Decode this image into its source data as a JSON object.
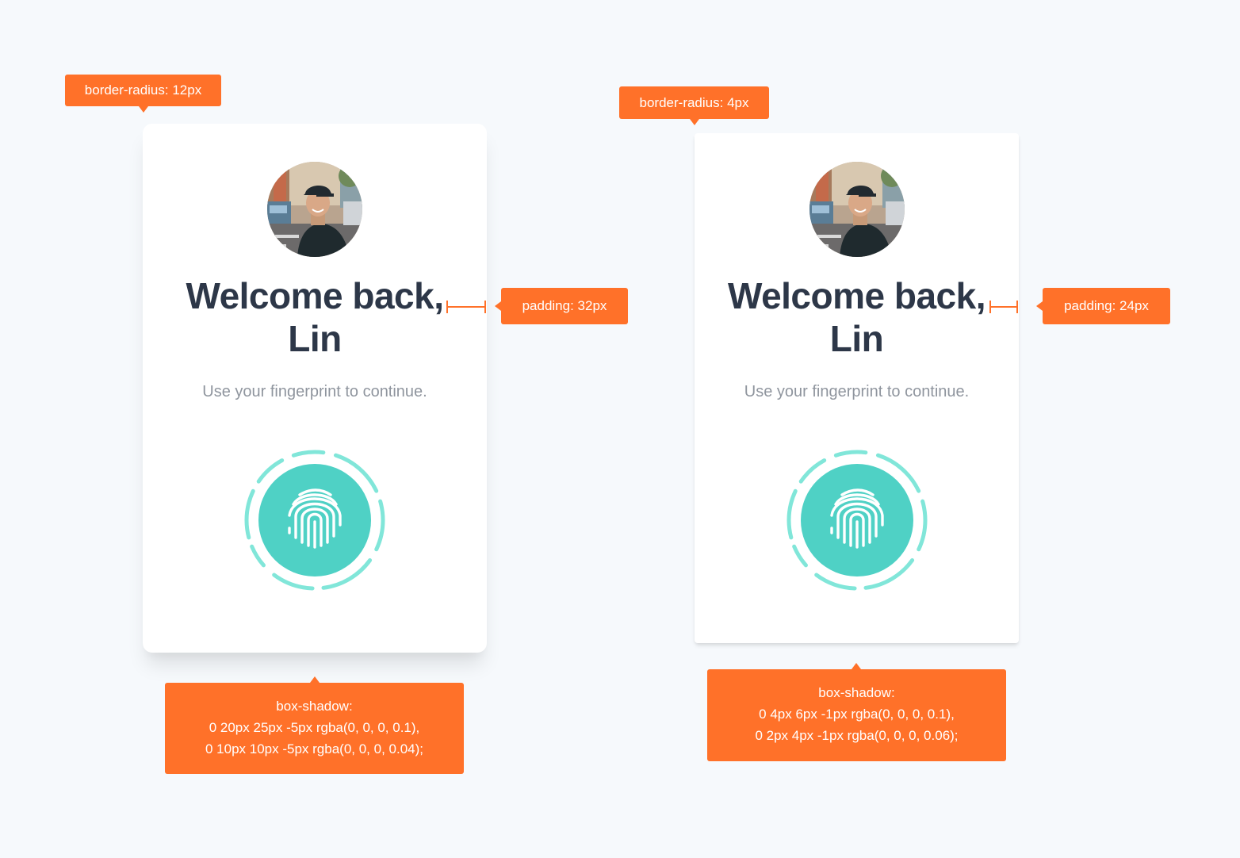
{
  "colors": {
    "background": "#f6f9fc",
    "card": "#ffffff",
    "heading": "#2d3748",
    "subtitle": "#8f959e",
    "accent_teal": "#4fd1c5",
    "ring_teal": "#81e6d9",
    "annotation": "#ff7129"
  },
  "left_card": {
    "greeting": "Welcome back,",
    "name": "Lin",
    "subtitle": "Use your fingerprint to continue.",
    "avatar_icon": "user-photo",
    "fingerprint_icon": "fingerprint-icon"
  },
  "right_card": {
    "greeting": "Welcome back,",
    "name": "Lin",
    "subtitle": "Use your fingerprint to continue.",
    "avatar_icon": "user-photo",
    "fingerprint_icon": "fingerprint-icon"
  },
  "annotations": {
    "left_radius": "border-radius: 12px",
    "right_radius": "border-radius: 4px",
    "left_padding": "padding: 32px",
    "right_padding": "padding: 24px",
    "left_shadow": [
      "box-shadow:",
      "0 20px 25px -5px rgba(0, 0, 0, 0.1),",
      "0 10px 10px -5px rgba(0, 0, 0, 0.04);"
    ],
    "right_shadow": [
      "box-shadow:",
      "0 4px 6px -1px rgba(0, 0, 0, 0.1),",
      "0 2px 4px -1px rgba(0, 0, 0, 0.06);"
    ]
  }
}
